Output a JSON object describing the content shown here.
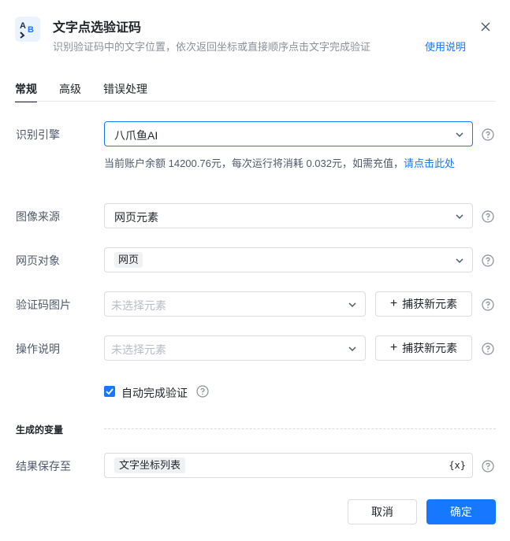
{
  "header": {
    "icon": "ab-icon",
    "title": "文字点选验证码",
    "subtitle": "识别验证码中的文字位置，依次返回坐标或直接顺序点击文字完成验证",
    "help_link": "使用说明"
  },
  "tabs": [
    {
      "label": "常规",
      "active": true
    },
    {
      "label": "高级",
      "active": false
    },
    {
      "label": "错误处理",
      "active": false
    }
  ],
  "form": {
    "engine": {
      "label": "识别引擎",
      "value": "八爪鱼AI"
    },
    "balance": {
      "text": "当前账户余额 14200.76元，每次运行将消耗 0.032元，如需充值，",
      "link": "请点击此处"
    },
    "image_source": {
      "label": "图像来源",
      "value": "网页元素"
    },
    "page_object": {
      "label": "网页对象",
      "value": "网页"
    },
    "captcha_image": {
      "label": "验证码图片",
      "placeholder": "未选择元素",
      "capture_label": "捕获新元素"
    },
    "instruction": {
      "label": "操作说明",
      "placeholder": "未选择元素",
      "capture_label": "捕获新元素"
    },
    "auto_complete": {
      "label": "自动完成验证",
      "checked": true
    }
  },
  "variables": {
    "section_title": "生成的变量",
    "result": {
      "label": "结果保存至",
      "value": "文字坐标列表",
      "icon_text": "{x}"
    }
  },
  "footer": {
    "cancel": "取消",
    "ok": "确定"
  },
  "colors": {
    "accent": "#1677ff",
    "border": "#d9dbe0",
    "muted": "#8a8f99"
  }
}
